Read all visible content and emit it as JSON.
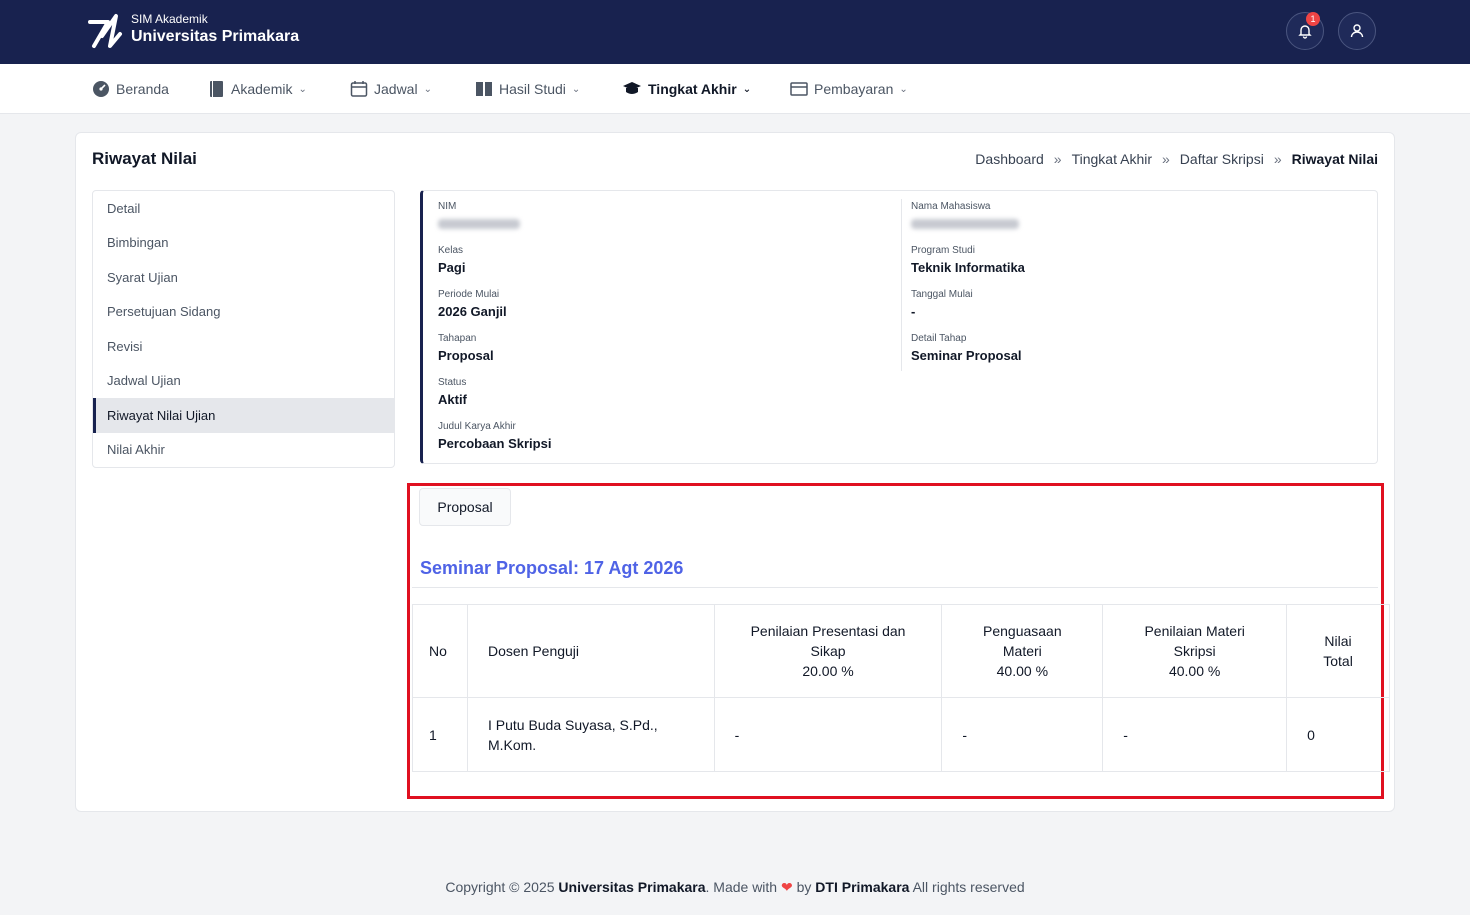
{
  "app": {
    "brand_small": "SIM Akademik",
    "brand_big": "Universitas Primakara",
    "notification_count": "1"
  },
  "nav": {
    "items": [
      {
        "label": "Beranda",
        "icon": "dashboard-icon"
      },
      {
        "label": "Akademik",
        "icon": "book-icon"
      },
      {
        "label": "Jadwal",
        "icon": "calendar-icon"
      },
      {
        "label": "Hasil Studi",
        "icon": "book-open-icon"
      },
      {
        "label": "Tingkat Akhir",
        "icon": "graduation-cap-icon"
      },
      {
        "label": "Pembayaran",
        "icon": "wallet-icon"
      }
    ]
  },
  "page": {
    "title": "Riwayat Nilai",
    "breadcrumb": [
      "Dashboard",
      "Tingkat Akhir",
      "Daftar Skripsi",
      "Riwayat Nilai"
    ]
  },
  "sidemenu": {
    "items": [
      "Detail",
      "Bimbingan",
      "Syarat Ujian",
      "Persetujuan Sidang",
      "Revisi",
      "Jadwal Ujian",
      "Riwayat Nilai Ujian",
      "Nilai Akhir"
    ]
  },
  "info": {
    "nim_label": "NIM",
    "nama_label": "Nama Mahasiswa",
    "kelas_label": "Kelas",
    "kelas": "Pagi",
    "prodi_label": "Program Studi",
    "prodi": "Teknik Informatika",
    "periode_label": "Periode Mulai",
    "periode": "2026 Ganjil",
    "tanggal_label": "Tanggal Mulai",
    "tanggal": "-",
    "tahapan_label": "Tahapan",
    "tahapan": "Proposal",
    "detail_label": "Detail Tahap",
    "detail": "Seminar Proposal",
    "status_label": "Status",
    "status": "Aktif",
    "judul_label": "Judul Karya Akhir",
    "judul": "Percobaan Skripsi"
  },
  "proposal": {
    "tab": "Proposal",
    "title": "Seminar Proposal: 17 Agt 2026",
    "headers": {
      "no": "No",
      "dosen": "Dosen Penguji",
      "presentasi_1": "Penilaian Presentasi dan",
      "presentasi_2": "Sikap",
      "presentasi_pct": "20.00 %",
      "penguasaan_1": "Penguasaan",
      "penguasaan_2": "Materi",
      "penguasaan_pct": "40.00 %",
      "materi_1": "Penilaian Materi",
      "materi_2": "Skripsi",
      "materi_pct": "40.00 %",
      "total_1": "Nilai",
      "total_2": "Total"
    },
    "rows": [
      {
        "no": "1",
        "dosen_1": "I Putu Buda Suyasa, S.Pd.,",
        "dosen_2": "M.Kom.",
        "presentasi": "-",
        "penguasaan": "-",
        "materi": "-",
        "total": "0"
      }
    ]
  },
  "footer": {
    "copyright": "Copyright © 2025",
    "org": "Universitas Primakara",
    "made_with": ". Made with",
    "by": "by",
    "team": "DTI Primakara",
    "rights": "All rights reserved"
  }
}
